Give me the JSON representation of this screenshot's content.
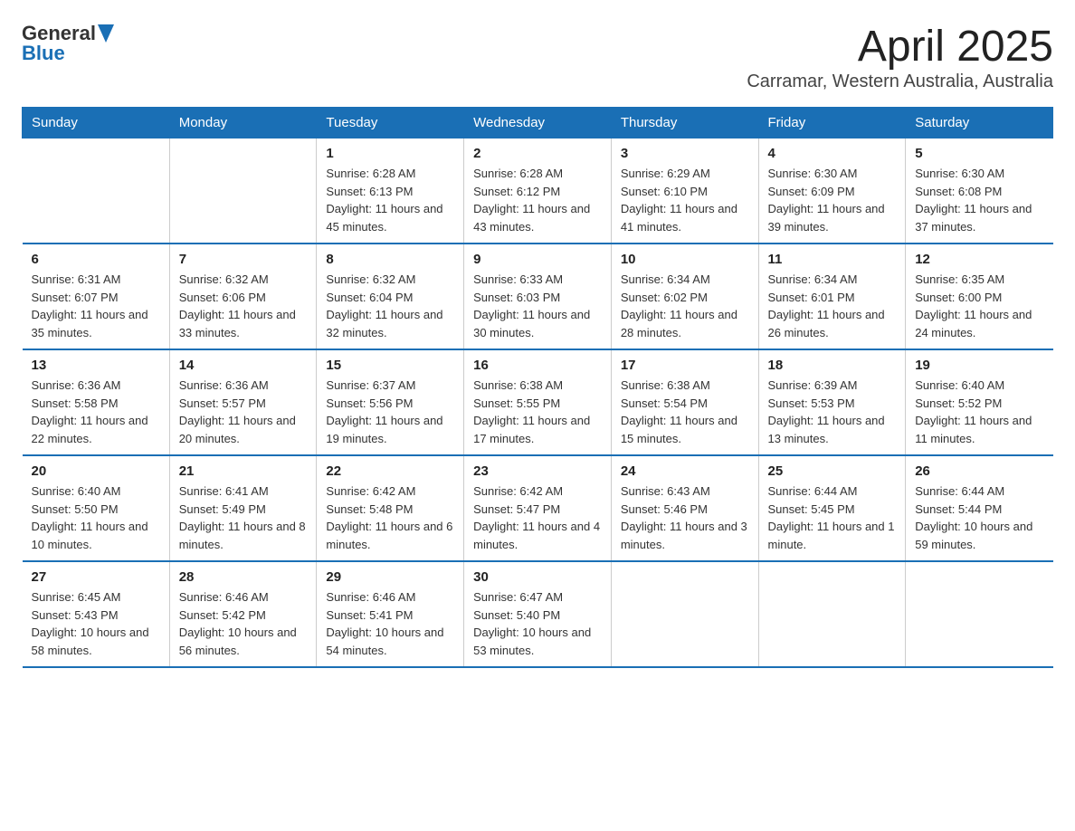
{
  "header": {
    "logo_general": "General",
    "logo_blue": "Blue",
    "month_title": "April 2025",
    "location": "Carramar, Western Australia, Australia"
  },
  "weekdays": [
    "Sunday",
    "Monday",
    "Tuesday",
    "Wednesday",
    "Thursday",
    "Friday",
    "Saturday"
  ],
  "weeks": [
    [
      {
        "day": "",
        "sunrise": "",
        "sunset": "",
        "daylight": ""
      },
      {
        "day": "",
        "sunrise": "",
        "sunset": "",
        "daylight": ""
      },
      {
        "day": "1",
        "sunrise": "Sunrise: 6:28 AM",
        "sunset": "Sunset: 6:13 PM",
        "daylight": "Daylight: 11 hours and 45 minutes."
      },
      {
        "day": "2",
        "sunrise": "Sunrise: 6:28 AM",
        "sunset": "Sunset: 6:12 PM",
        "daylight": "Daylight: 11 hours and 43 minutes."
      },
      {
        "day": "3",
        "sunrise": "Sunrise: 6:29 AM",
        "sunset": "Sunset: 6:10 PM",
        "daylight": "Daylight: 11 hours and 41 minutes."
      },
      {
        "day": "4",
        "sunrise": "Sunrise: 6:30 AM",
        "sunset": "Sunset: 6:09 PM",
        "daylight": "Daylight: 11 hours and 39 minutes."
      },
      {
        "day": "5",
        "sunrise": "Sunrise: 6:30 AM",
        "sunset": "Sunset: 6:08 PM",
        "daylight": "Daylight: 11 hours and 37 minutes."
      }
    ],
    [
      {
        "day": "6",
        "sunrise": "Sunrise: 6:31 AM",
        "sunset": "Sunset: 6:07 PM",
        "daylight": "Daylight: 11 hours and 35 minutes."
      },
      {
        "day": "7",
        "sunrise": "Sunrise: 6:32 AM",
        "sunset": "Sunset: 6:06 PM",
        "daylight": "Daylight: 11 hours and 33 minutes."
      },
      {
        "day": "8",
        "sunrise": "Sunrise: 6:32 AM",
        "sunset": "Sunset: 6:04 PM",
        "daylight": "Daylight: 11 hours and 32 minutes."
      },
      {
        "day": "9",
        "sunrise": "Sunrise: 6:33 AM",
        "sunset": "Sunset: 6:03 PM",
        "daylight": "Daylight: 11 hours and 30 minutes."
      },
      {
        "day": "10",
        "sunrise": "Sunrise: 6:34 AM",
        "sunset": "Sunset: 6:02 PM",
        "daylight": "Daylight: 11 hours and 28 minutes."
      },
      {
        "day": "11",
        "sunrise": "Sunrise: 6:34 AM",
        "sunset": "Sunset: 6:01 PM",
        "daylight": "Daylight: 11 hours and 26 minutes."
      },
      {
        "day": "12",
        "sunrise": "Sunrise: 6:35 AM",
        "sunset": "Sunset: 6:00 PM",
        "daylight": "Daylight: 11 hours and 24 minutes."
      }
    ],
    [
      {
        "day": "13",
        "sunrise": "Sunrise: 6:36 AM",
        "sunset": "Sunset: 5:58 PM",
        "daylight": "Daylight: 11 hours and 22 minutes."
      },
      {
        "day": "14",
        "sunrise": "Sunrise: 6:36 AM",
        "sunset": "Sunset: 5:57 PM",
        "daylight": "Daylight: 11 hours and 20 minutes."
      },
      {
        "day": "15",
        "sunrise": "Sunrise: 6:37 AM",
        "sunset": "Sunset: 5:56 PM",
        "daylight": "Daylight: 11 hours and 19 minutes."
      },
      {
        "day": "16",
        "sunrise": "Sunrise: 6:38 AM",
        "sunset": "Sunset: 5:55 PM",
        "daylight": "Daylight: 11 hours and 17 minutes."
      },
      {
        "day": "17",
        "sunrise": "Sunrise: 6:38 AM",
        "sunset": "Sunset: 5:54 PM",
        "daylight": "Daylight: 11 hours and 15 minutes."
      },
      {
        "day": "18",
        "sunrise": "Sunrise: 6:39 AM",
        "sunset": "Sunset: 5:53 PM",
        "daylight": "Daylight: 11 hours and 13 minutes."
      },
      {
        "day": "19",
        "sunrise": "Sunrise: 6:40 AM",
        "sunset": "Sunset: 5:52 PM",
        "daylight": "Daylight: 11 hours and 11 minutes."
      }
    ],
    [
      {
        "day": "20",
        "sunrise": "Sunrise: 6:40 AM",
        "sunset": "Sunset: 5:50 PM",
        "daylight": "Daylight: 11 hours and 10 minutes."
      },
      {
        "day": "21",
        "sunrise": "Sunrise: 6:41 AM",
        "sunset": "Sunset: 5:49 PM",
        "daylight": "Daylight: 11 hours and 8 minutes."
      },
      {
        "day": "22",
        "sunrise": "Sunrise: 6:42 AM",
        "sunset": "Sunset: 5:48 PM",
        "daylight": "Daylight: 11 hours and 6 minutes."
      },
      {
        "day": "23",
        "sunrise": "Sunrise: 6:42 AM",
        "sunset": "Sunset: 5:47 PM",
        "daylight": "Daylight: 11 hours and 4 minutes."
      },
      {
        "day": "24",
        "sunrise": "Sunrise: 6:43 AM",
        "sunset": "Sunset: 5:46 PM",
        "daylight": "Daylight: 11 hours and 3 minutes."
      },
      {
        "day": "25",
        "sunrise": "Sunrise: 6:44 AM",
        "sunset": "Sunset: 5:45 PM",
        "daylight": "Daylight: 11 hours and 1 minute."
      },
      {
        "day": "26",
        "sunrise": "Sunrise: 6:44 AM",
        "sunset": "Sunset: 5:44 PM",
        "daylight": "Daylight: 10 hours and 59 minutes."
      }
    ],
    [
      {
        "day": "27",
        "sunrise": "Sunrise: 6:45 AM",
        "sunset": "Sunset: 5:43 PM",
        "daylight": "Daylight: 10 hours and 58 minutes."
      },
      {
        "day": "28",
        "sunrise": "Sunrise: 6:46 AM",
        "sunset": "Sunset: 5:42 PM",
        "daylight": "Daylight: 10 hours and 56 minutes."
      },
      {
        "day": "29",
        "sunrise": "Sunrise: 6:46 AM",
        "sunset": "Sunset: 5:41 PM",
        "daylight": "Daylight: 10 hours and 54 minutes."
      },
      {
        "day": "30",
        "sunrise": "Sunrise: 6:47 AM",
        "sunset": "Sunset: 5:40 PM",
        "daylight": "Daylight: 10 hours and 53 minutes."
      },
      {
        "day": "",
        "sunrise": "",
        "sunset": "",
        "daylight": ""
      },
      {
        "day": "",
        "sunrise": "",
        "sunset": "",
        "daylight": ""
      },
      {
        "day": "",
        "sunrise": "",
        "sunset": "",
        "daylight": ""
      }
    ]
  ]
}
